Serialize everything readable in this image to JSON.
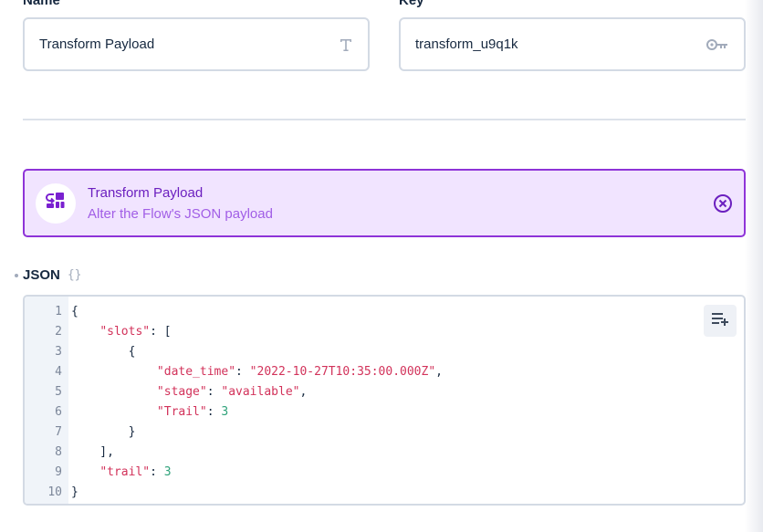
{
  "name_field": {
    "label": "Name",
    "value": "Transform Payload",
    "icon": "text-type-icon"
  },
  "key_field": {
    "label": "Key",
    "value": "transform_u9q1k",
    "icon": "key-icon"
  },
  "operation": {
    "title": "Transform Payload",
    "description": "Alter the Flow's JSON payload",
    "icon": "transform-icon",
    "close_icon": "close-circle-icon"
  },
  "json_section": {
    "label": "JSON",
    "icon_text": "{}"
  },
  "editor": {
    "line_numbers": [
      "1",
      "2",
      "3",
      "4",
      "5",
      "6",
      "7",
      "8",
      "9",
      "10"
    ],
    "lines": [
      [
        {
          "t": "p",
          "v": "{"
        }
      ],
      [
        {
          "t": "p",
          "v": "    "
        },
        {
          "t": "k",
          "v": "\"slots\""
        },
        {
          "t": "p",
          "v": ": ["
        }
      ],
      [
        {
          "t": "p",
          "v": "        {"
        }
      ],
      [
        {
          "t": "p",
          "v": "            "
        },
        {
          "t": "k",
          "v": "\"date_time\""
        },
        {
          "t": "p",
          "v": ": "
        },
        {
          "t": "k",
          "v": "\"2022-10-27T10:35:00.000Z\""
        },
        {
          "t": "p",
          "v": ","
        }
      ],
      [
        {
          "t": "p",
          "v": "            "
        },
        {
          "t": "k",
          "v": "\"stage\""
        },
        {
          "t": "p",
          "v": ": "
        },
        {
          "t": "k",
          "v": "\"available\""
        },
        {
          "t": "p",
          "v": ","
        }
      ],
      [
        {
          "t": "p",
          "v": "            "
        },
        {
          "t": "k",
          "v": "\"Trail\""
        },
        {
          "t": "p",
          "v": ": "
        },
        {
          "t": "n",
          "v": "3"
        }
      ],
      [
        {
          "t": "p",
          "v": "        }"
        }
      ],
      [
        {
          "t": "p",
          "v": "    ],"
        }
      ],
      [
        {
          "t": "p",
          "v": "    "
        },
        {
          "t": "k",
          "v": "\"trail\""
        },
        {
          "t": "p",
          "v": ": "
        },
        {
          "t": "n",
          "v": "3"
        }
      ],
      [
        {
          "t": "p",
          "v": "}"
        }
      ]
    ],
    "format_button_icon": "playlist-add-icon"
  },
  "colors": {
    "accent": "#8e33d8",
    "accent_bg": "#f1e4ff",
    "string": "#d2325a",
    "number": "#2ea27a"
  }
}
